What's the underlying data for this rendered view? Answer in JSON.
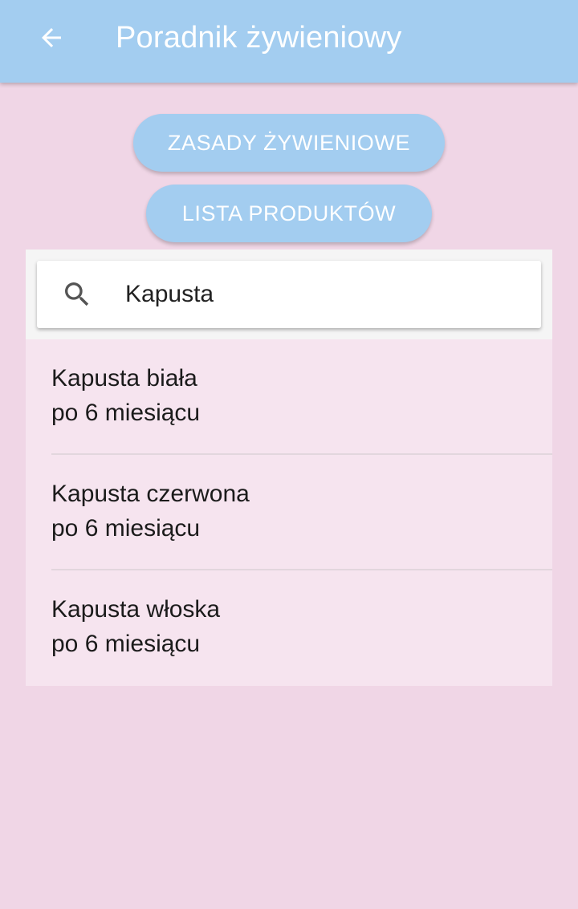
{
  "appbar": {
    "title": "Poradnik żywieniowy",
    "back_icon": "arrow-left-icon",
    "background_color": "#a3cdf0"
  },
  "buttons": {
    "rules_label": "ZASADY ŻYWIENIOWE",
    "products_label": "LISTA PRODUKTÓW"
  },
  "search": {
    "icon": "search-icon",
    "value": "Kapusta"
  },
  "results": [
    {
      "name": "Kapusta biała",
      "age": "po 6 miesiącu"
    },
    {
      "name": "Kapusta czerwona",
      "age": "po 6 miesiącu"
    },
    {
      "name": "Kapusta włoska",
      "age": "po 6 miesiącu"
    }
  ],
  "colors": {
    "page_background": "#f0d6e6",
    "list_background": "#f6e4ef",
    "accent": "#a3cdf0"
  }
}
